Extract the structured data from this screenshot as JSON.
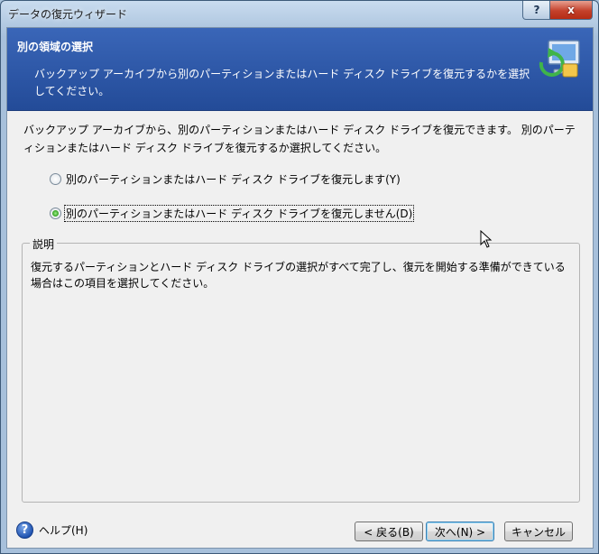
{
  "window": {
    "title": "データの復元ウィザード",
    "help_button": "?",
    "close_button": "x"
  },
  "header": {
    "title": "別の領域の選択",
    "description": "バックアップ アーカイブから別のパーティションまたはハード ディスク ドライブを復元するかを選択してください。"
  },
  "intro_text": "バックアップ アーカイブから、別のパーティションまたはハード ディスク ドライブを復元できます。 別のパーティションまたはハード ディスク ドライブを復元するか選択してください。",
  "options": [
    {
      "label": "別のパーティションまたはハード ディスク ドライブを復元します(Y)",
      "checked": false
    },
    {
      "label": "別のパーティションまたはハード ディスク ドライブを復元しません(D)",
      "checked": true
    }
  ],
  "description_box": {
    "legend": "説明",
    "text": "復元するパーティションとハード ディスク ドライブの選択がすべて完了し、復元を開始する準備ができている場合はこの項目を選択してください。"
  },
  "footer": {
    "help_label": "ヘルプ(H)",
    "back_label": "< 戻る(B)",
    "next_label": "次へ(N) >",
    "cancel_label": "キャンセル"
  }
}
